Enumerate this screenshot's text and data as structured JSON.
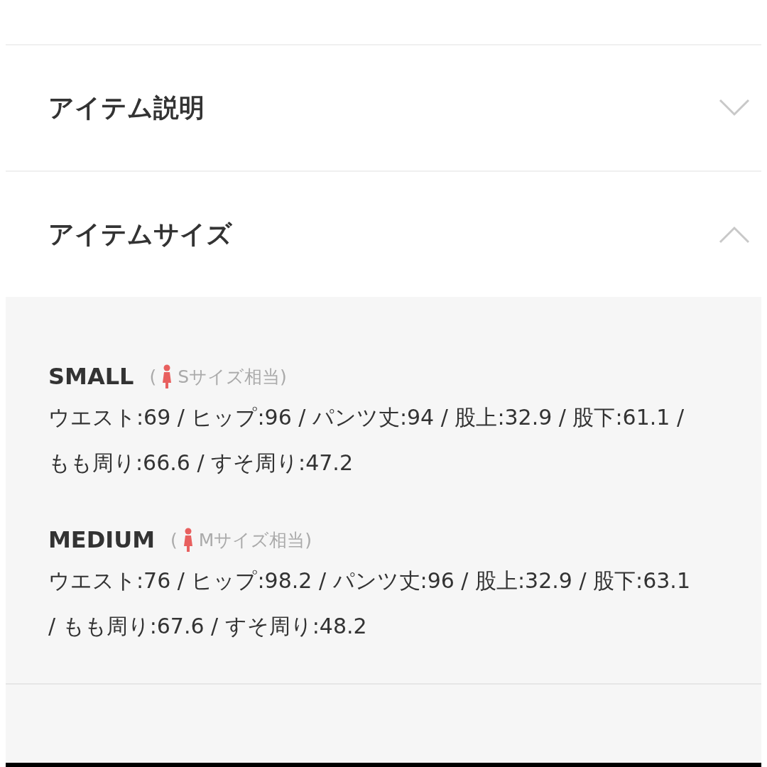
{
  "sections": [
    {
      "title": "アイテム説明",
      "expanded": false
    },
    {
      "title": "アイテムサイズ",
      "expanded": true,
      "sizes": [
        {
          "name": "SMALL",
          "paren": "(",
          "note": "Sサイズ相当)",
          "measurements": "ウエスト:69 / ヒップ:96 / パンツ丈:94 / 股上:32.9 / 股下:61.1 / もも周り:66.6 / すそ周り:47.2"
        },
        {
          "name": "MEDIUM",
          "paren": "(",
          "note": "Mサイズ相当)",
          "measurements": "ウエスト:76 / ヒップ:98.2 / パンツ丈:96 / 股上:32.9 / 股下:63.1 / もも周り:67.6 / すそ周り:48.2"
        }
      ]
    }
  ]
}
